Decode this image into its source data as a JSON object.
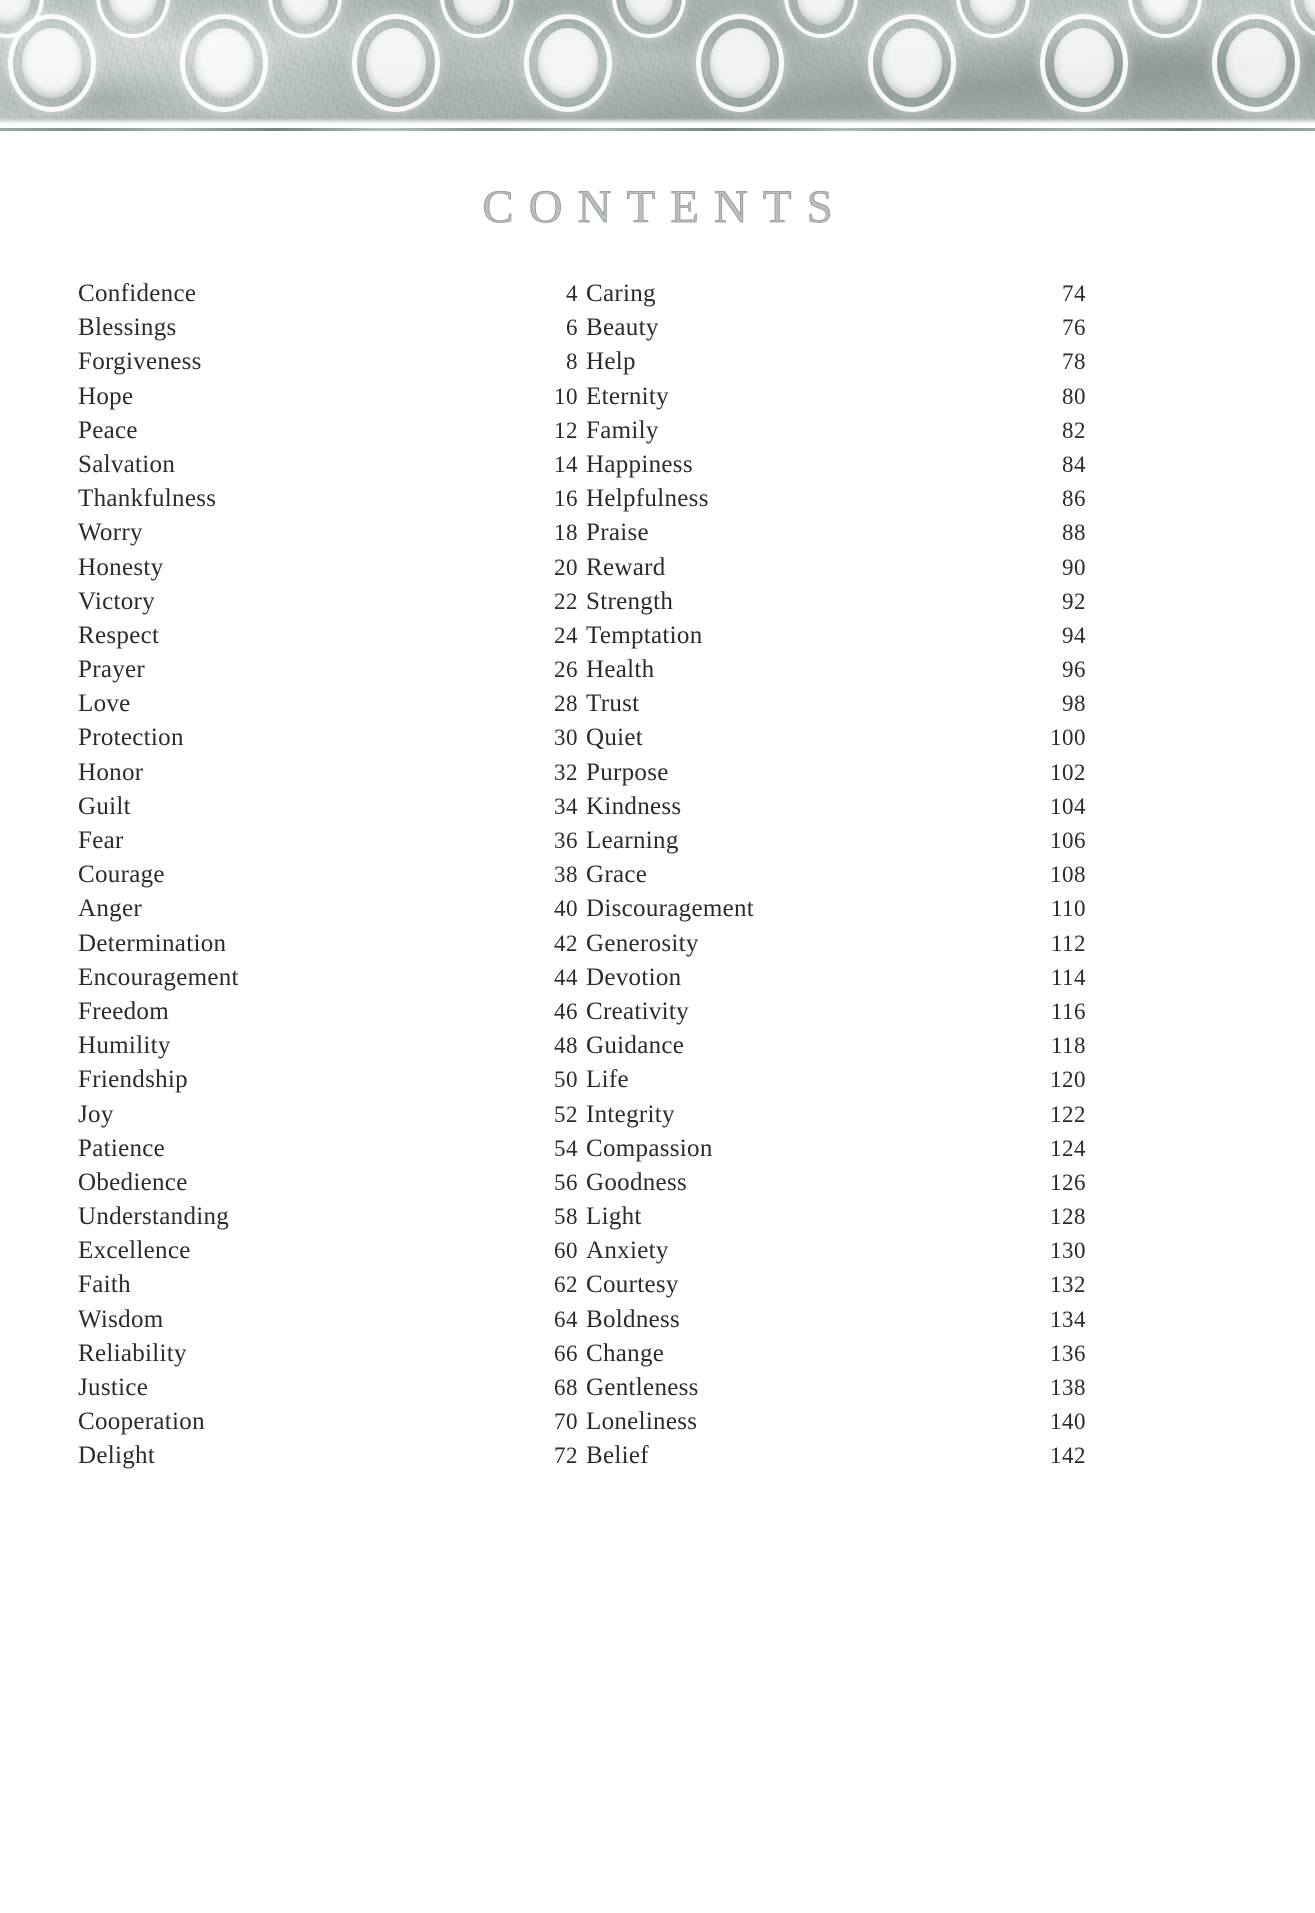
{
  "header": {
    "decoration_name": "photographic-ring-border-band"
  },
  "title": "CONTENTS",
  "colors": {
    "text": "#2b2b2b",
    "title": "#b9bdbd",
    "band": "#b7c1be"
  },
  "columns": [
    {
      "name": "left-column",
      "entries": [
        {
          "title": "Confidence",
          "page": "4"
        },
        {
          "title": "Blessings",
          "page": "6"
        },
        {
          "title": "Forgiveness",
          "page": "8"
        },
        {
          "title": "Hope",
          "page": "10"
        },
        {
          "title": "Peace",
          "page": "12"
        },
        {
          "title": "Salvation",
          "page": "14"
        },
        {
          "title": "Thankfulness",
          "page": "16"
        },
        {
          "title": "Worry",
          "page": "18"
        },
        {
          "title": "Honesty",
          "page": "20"
        },
        {
          "title": "Victory",
          "page": "22"
        },
        {
          "title": "Respect",
          "page": "24"
        },
        {
          "title": "Prayer",
          "page": "26"
        },
        {
          "title": "Love",
          "page": "28"
        },
        {
          "title": "Protection",
          "page": "30"
        },
        {
          "title": "Honor",
          "page": "32"
        },
        {
          "title": "Guilt",
          "page": "34"
        },
        {
          "title": "Fear",
          "page": "36"
        },
        {
          "title": "Courage",
          "page": "38"
        },
        {
          "title": "Anger",
          "page": "40"
        },
        {
          "title": "Determination",
          "page": "42"
        },
        {
          "title": "Encouragement",
          "page": "44"
        },
        {
          "title": "Freedom",
          "page": "46"
        },
        {
          "title": "Humility",
          "page": "48"
        },
        {
          "title": "Friendship",
          "page": "50"
        },
        {
          "title": "Joy",
          "page": "52"
        },
        {
          "title": "Patience",
          "page": "54"
        },
        {
          "title": "Obedience",
          "page": "56"
        },
        {
          "title": "Understanding",
          "page": "58"
        },
        {
          "title": "Excellence",
          "page": "60"
        },
        {
          "title": "Faith",
          "page": "62"
        },
        {
          "title": "Wisdom",
          "page": "64"
        },
        {
          "title": "Reliability",
          "page": "66"
        },
        {
          "title": "Justice",
          "page": "68"
        },
        {
          "title": "Cooperation",
          "page": "70"
        },
        {
          "title": "Delight",
          "page": "72"
        }
      ]
    },
    {
      "name": "right-column",
      "entries": [
        {
          "title": "Caring",
          "page": "74"
        },
        {
          "title": "Beauty",
          "page": "76"
        },
        {
          "title": "Help",
          "page": "78"
        },
        {
          "title": "Eternity",
          "page": "80"
        },
        {
          "title": "Family",
          "page": "82"
        },
        {
          "title": "Happiness",
          "page": "84"
        },
        {
          "title": "Helpfulness",
          "page": "86"
        },
        {
          "title": "Praise",
          "page": "88"
        },
        {
          "title": "Reward",
          "page": "90"
        },
        {
          "title": "Strength",
          "page": "92"
        },
        {
          "title": "Temptation",
          "page": "94"
        },
        {
          "title": "Health",
          "page": "96"
        },
        {
          "title": "Trust",
          "page": "98"
        },
        {
          "title": "Quiet",
          "page": "100"
        },
        {
          "title": "Purpose",
          "page": "102"
        },
        {
          "title": "Kindness",
          "page": "104"
        },
        {
          "title": "Learning",
          "page": "106"
        },
        {
          "title": "Grace",
          "page": "108"
        },
        {
          "title": "Discouragement",
          "page": "110"
        },
        {
          "title": "Generosity",
          "page": "112"
        },
        {
          "title": "Devotion",
          "page": "114"
        },
        {
          "title": "Creativity",
          "page": "116"
        },
        {
          "title": "Guidance",
          "page": "118"
        },
        {
          "title": "Life",
          "page": "120"
        },
        {
          "title": "Integrity",
          "page": "122"
        },
        {
          "title": "Compassion",
          "page": "124"
        },
        {
          "title": "Goodness",
          "page": "126"
        },
        {
          "title": "Light",
          "page": "128"
        },
        {
          "title": "Anxiety",
          "page": "130"
        },
        {
          "title": "Courtesy",
          "page": "132"
        },
        {
          "title": "Boldness",
          "page": "134"
        },
        {
          "title": "Change",
          "page": "136"
        },
        {
          "title": "Gentleness",
          "page": "138"
        },
        {
          "title": "Loneliness",
          "page": "140"
        },
        {
          "title": "Belief",
          "page": "142"
        }
      ]
    }
  ]
}
